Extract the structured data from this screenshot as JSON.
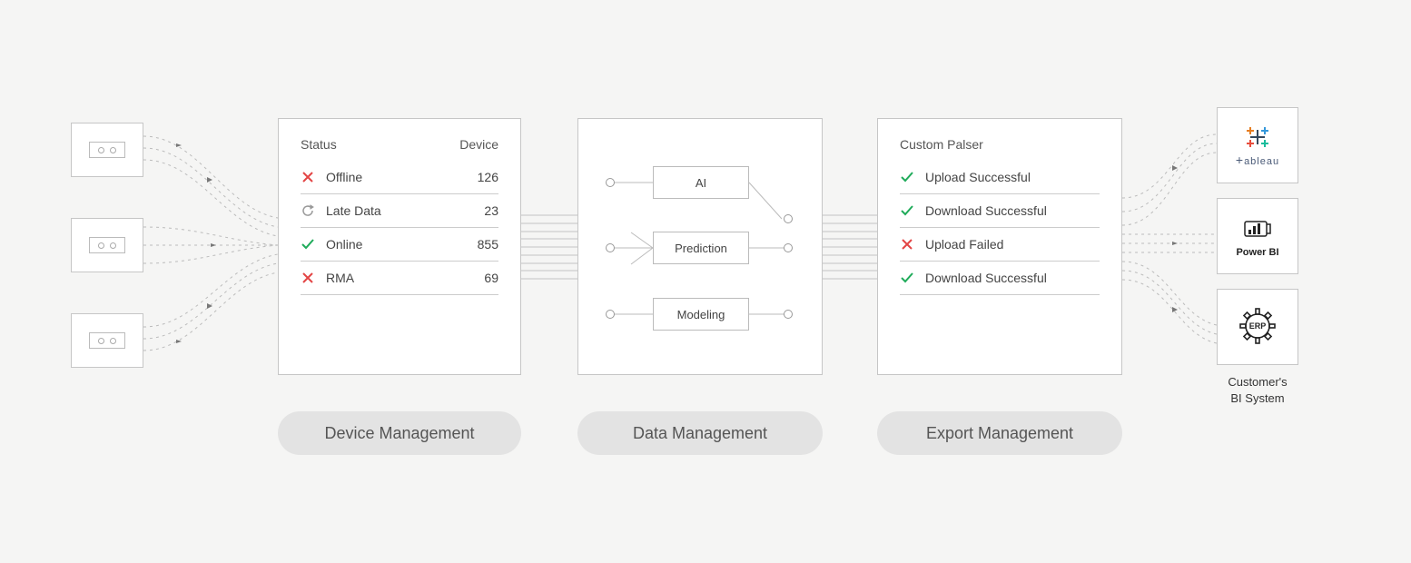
{
  "device_panel": {
    "header_status": "Status",
    "header_device": "Device",
    "rows": [
      {
        "icon": "x",
        "label": "Offline",
        "value": "126"
      },
      {
        "icon": "refresh",
        "label": "Late Data",
        "value": "23"
      },
      {
        "icon": "check",
        "label": "Online",
        "value": "855"
      },
      {
        "icon": "x",
        "label": "RMA",
        "value": "69"
      }
    ]
  },
  "data_panel": {
    "nodes": {
      "ai": "AI",
      "prediction": "Prediction",
      "modeling": "Modeling"
    }
  },
  "export_panel": {
    "header": "Custom Palser",
    "rows": [
      {
        "icon": "check",
        "label": "Upload Successful"
      },
      {
        "icon": "check",
        "label": "Download Successful"
      },
      {
        "icon": "x",
        "label": "Upload Failed"
      },
      {
        "icon": "check",
        "label": "Download Successful"
      }
    ]
  },
  "pills": {
    "device": "Device Management",
    "data": "Data Management",
    "export": "Export Management"
  },
  "bi": {
    "tableau": "ableau",
    "powerbi": "Power BI",
    "erp": "ERP",
    "caption_l1": "Customer's",
    "caption_l2": "BI System"
  }
}
